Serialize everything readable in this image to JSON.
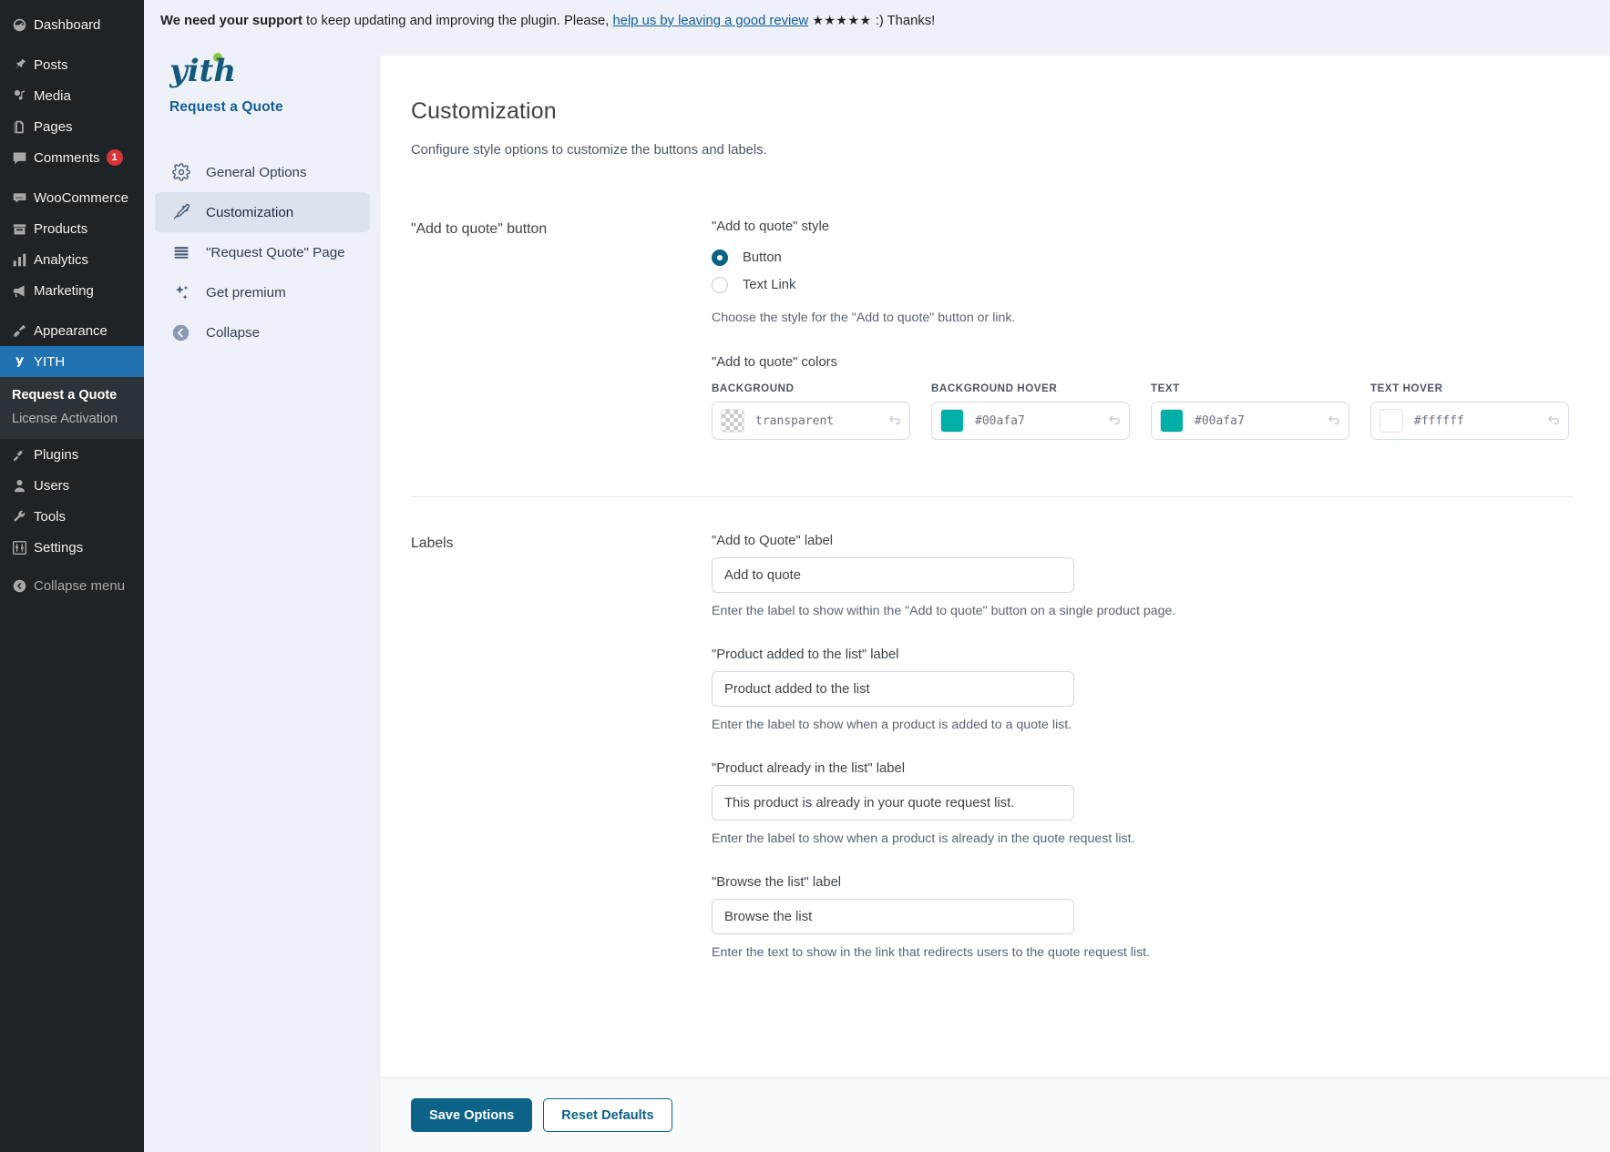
{
  "wp_sidebar": {
    "items": [
      {
        "label": "Dashboard",
        "icon": "dashboard-icon",
        "badge": null,
        "active": false
      },
      {
        "label": "Posts",
        "icon": "pin-icon",
        "badge": null,
        "active": false
      },
      {
        "label": "Media",
        "icon": "media-icon",
        "badge": null,
        "active": false
      },
      {
        "label": "Pages",
        "icon": "pages-icon",
        "badge": null,
        "active": false
      },
      {
        "label": "Comments",
        "icon": "comment-icon",
        "badge": "1",
        "active": false
      },
      {
        "label": "WooCommerce",
        "icon": "woo-icon",
        "badge": null,
        "active": false
      },
      {
        "label": "Products",
        "icon": "products-icon",
        "badge": null,
        "active": false
      },
      {
        "label": "Analytics",
        "icon": "analytics-icon",
        "badge": null,
        "active": false
      },
      {
        "label": "Marketing",
        "icon": "megaphone-icon",
        "badge": null,
        "active": false
      },
      {
        "label": "Appearance",
        "icon": "brush-icon",
        "badge": null,
        "active": false
      },
      {
        "label": "YITH",
        "icon": "yith-icon",
        "badge": null,
        "active": true
      }
    ],
    "submenu": [
      {
        "label": "Request a Quote",
        "current": true
      },
      {
        "label": "License Activation",
        "current": false
      }
    ],
    "items_after": [
      {
        "label": "Plugins",
        "icon": "plug-icon",
        "badge": null,
        "active": false
      },
      {
        "label": "Users",
        "icon": "user-icon",
        "badge": null,
        "active": false
      },
      {
        "label": "Tools",
        "icon": "wrench-icon",
        "badge": null,
        "active": false
      },
      {
        "label": "Settings",
        "icon": "sliders-icon",
        "badge": null,
        "active": false
      }
    ],
    "collapse": {
      "label": "Collapse menu",
      "icon": "collapse-arrow-icon"
    }
  },
  "notice": {
    "bold": "We need your support",
    "text_before_link": " to keep updating and improving the plugin. Please, ",
    "link": "help us by leaving a good review",
    "stars": "★★★★★",
    "text_after": " :) Thanks!"
  },
  "plugin_nav": {
    "brand_name": "yith",
    "brand_sub": "Request a Quote",
    "items": [
      {
        "label": "General Options",
        "icon": "gear-icon",
        "selected": false
      },
      {
        "label": "Customization",
        "icon": "eyedropper-icon",
        "selected": true
      },
      {
        "label": "\"Request Quote\" Page",
        "icon": "lines-icon",
        "selected": false
      },
      {
        "label": "Get premium",
        "icon": "sparkles-icon",
        "selected": false
      },
      {
        "label": "Collapse",
        "icon": "collapse-circle-icon",
        "selected": false
      }
    ]
  },
  "page": {
    "title": "Customization",
    "description": "Configure style options to customize the buttons and labels."
  },
  "button_section": {
    "section_label": "\"Add to quote\" button",
    "style_field_title": "\"Add to quote\" style",
    "options": [
      {
        "label": "Button",
        "checked": true
      },
      {
        "label": "Text Link",
        "checked": false
      }
    ],
    "style_help": "Choose the style for the \"Add to quote\" button or link.",
    "colors_title": "\"Add to quote\" colors",
    "colors": [
      {
        "caption": "BACKGROUND",
        "value": "transparent",
        "swatch": "transparent"
      },
      {
        "caption": "BACKGROUND HOVER",
        "value": "#00afa7",
        "swatch": "#00afa7"
      },
      {
        "caption": "TEXT",
        "value": "#00afa7",
        "swatch": "#00afa7"
      },
      {
        "caption": "TEXT HOVER",
        "value": "#ffffff",
        "swatch": "#ffffff"
      }
    ]
  },
  "labels_section": {
    "section_label": "Labels",
    "fields": [
      {
        "title": "\"Add to Quote\" label",
        "value": "Add to quote",
        "help": "Enter the label to show within the \"Add to quote\" button on a single product page."
      },
      {
        "title": "\"Product added to the list\" label",
        "value": "Product added to the list",
        "help": "Enter the label to show when a product is added to a quote list."
      },
      {
        "title": "\"Product already in the list\" label",
        "value": "This product is already in your quote request list.",
        "help": "Enter the label to show when a product is already in the quote request list."
      },
      {
        "title": "\"Browse the list\" label",
        "value": "Browse the list",
        "help": "Enter the text to show in the link that redirects users to the quote request list."
      }
    ]
  },
  "footer": {
    "save_label": "Save Options",
    "reset_label": "Reset Defaults"
  },
  "colors": {
    "wp_sidebar_bg": "#1d2327",
    "wp_active_bg": "#2271b1",
    "badge_red": "#d63638",
    "panel_bg": "#eef1f8",
    "brand_blue": "#135e96",
    "accent_teal": "#00afa7",
    "primary_button": "#0d6287"
  }
}
